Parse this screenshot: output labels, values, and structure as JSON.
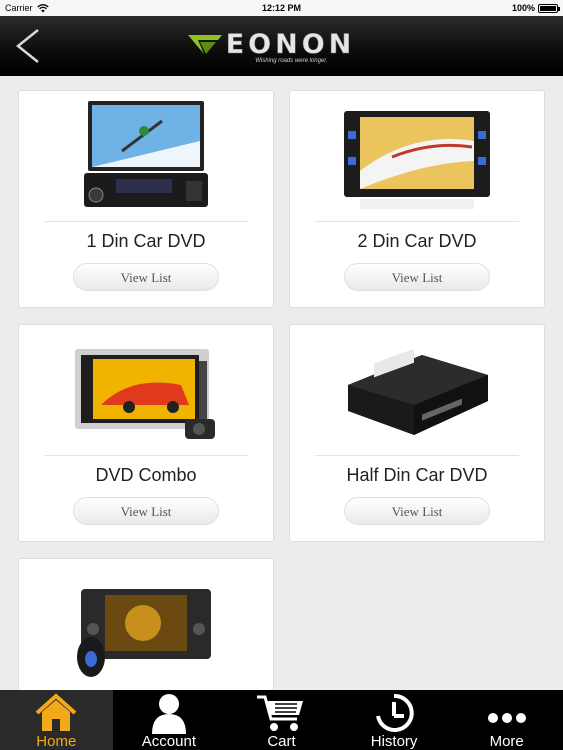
{
  "status_bar": {
    "carrier": "Carrier",
    "time": "12:12 PM",
    "battery": "100%"
  },
  "navbar": {
    "logo_text": "EONON",
    "slogan": "Wishing roads were longer."
  },
  "products": [
    {
      "title": "1 Din Car DVD",
      "button": "View List"
    },
    {
      "title": "2 Din Car DVD",
      "button": "View List"
    },
    {
      "title": "DVD Combo",
      "button": "View List"
    },
    {
      "title": "Half Din Car DVD",
      "button": "View List"
    },
    {
      "title": "",
      "button": ""
    }
  ],
  "tabs": [
    {
      "label": "Home",
      "icon": "home-icon",
      "active": true
    },
    {
      "label": "Account",
      "icon": "account-icon",
      "active": false
    },
    {
      "label": "Cart",
      "icon": "cart-icon",
      "active": false
    },
    {
      "label": "History",
      "icon": "history-icon",
      "active": false
    },
    {
      "label": "More",
      "icon": "more-icon",
      "active": false
    }
  ],
  "colors": {
    "active_tab": "#f2a91a",
    "logo_green": "#8fc31f",
    "background": "#ececec"
  }
}
